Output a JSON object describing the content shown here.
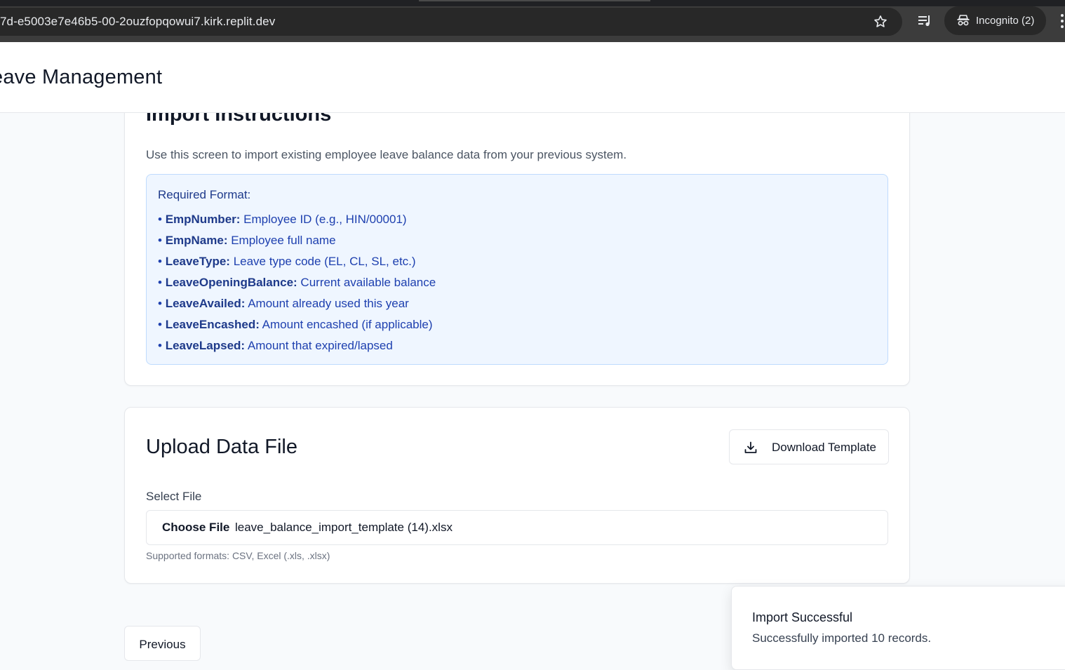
{
  "browser": {
    "url": "7d-e5003e7e46b5-00-2ouzfopqowui7.kirk.replit.dev",
    "incognito_label": "Incognito (2)",
    "icons": [
      "star-icon",
      "media-control-icon",
      "incognito-icon",
      "more-vert-icon"
    ]
  },
  "app": {
    "title": "eave Management"
  },
  "instructions": {
    "title": "Import Instructions",
    "description": "Use this screen to import existing employee leave balance data from your previous system.",
    "format_heading": "Required Format:",
    "fields": [
      {
        "name": "EmpNumber:",
        "desc": " Employee ID (e.g., HIN/00001)"
      },
      {
        "name": "EmpName:",
        "desc": " Employee full name"
      },
      {
        "name": "LeaveType:",
        "desc": " Leave type code (EL, CL, SL, etc.)"
      },
      {
        "name": "LeaveOpeningBalance:",
        "desc": " Current available balance"
      },
      {
        "name": "LeaveAvailed:",
        "desc": " Amount already used this year"
      },
      {
        "name": "LeaveEncashed:",
        "desc": " Amount encashed (if applicable)"
      },
      {
        "name": "LeaveLapsed:",
        "desc": " Amount that expired/lapsed"
      }
    ],
    "bullet": "•"
  },
  "upload": {
    "title": "Upload Data File",
    "download_label": "Download Template",
    "select_label": "Select File",
    "choose_label": "Choose File",
    "file_name": "leave_balance_import_template (14).xlsx",
    "help": "Supported formats: CSV, Excel (.xls, .xlsx)"
  },
  "nav": {
    "previous_label": "Previous"
  },
  "toast": {
    "title": "Import Successful",
    "message": "Successfully imported 10 records."
  },
  "colors": {
    "accent_blue": "#1e40af",
    "info_bg": "#eff6ff",
    "info_border": "#bfdbfe"
  }
}
